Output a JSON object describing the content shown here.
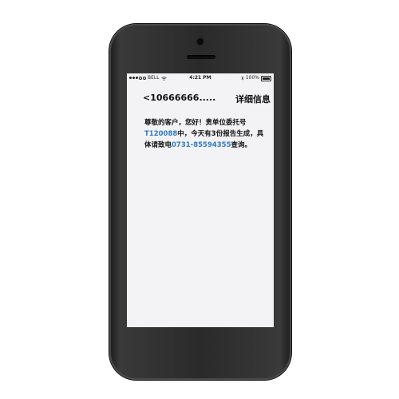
{
  "status_bar": {
    "carrier": "BELL",
    "time": "4:21 PM",
    "battery": "100%"
  },
  "nav": {
    "back_label": "<10666666.....",
    "details_label": "详细信息"
  },
  "message": {
    "part1": "尊敬的客户，您好！贵单位委托号",
    "order_no": "T120088",
    "part2": "中，今天有3份报告生成，具体请致电",
    "phone": "0731-85594355",
    "part3": "查询。"
  }
}
